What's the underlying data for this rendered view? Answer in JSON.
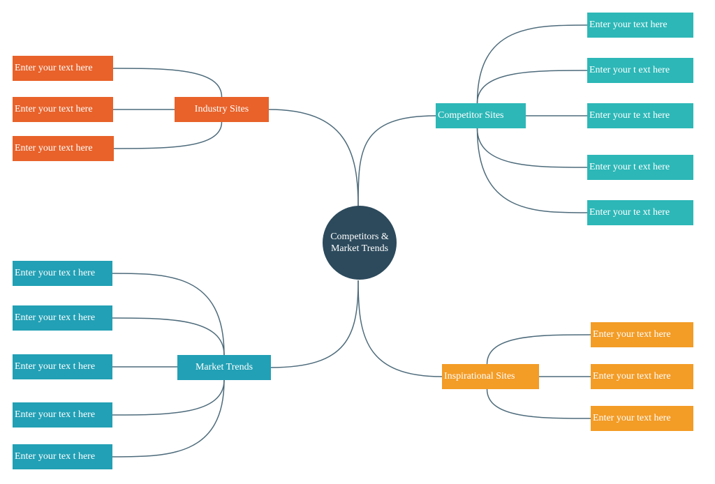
{
  "colors": {
    "link": "#4d6b7b",
    "center": "#2c4a5c",
    "industry": "#e8622a",
    "competitor": "#2db7b7",
    "market": "#22a0b5",
    "inspirational": "#f39c26"
  },
  "center": {
    "label_line1": "Competitors &",
    "label_line2": "Market Trends"
  },
  "branches": [
    {
      "id": "industry",
      "label": "Industry Sites",
      "color": "#e8622a",
      "leaves": [
        "Enter your text here",
        "Enter your text here",
        "Enter your text here"
      ]
    },
    {
      "id": "competitor",
      "label": "Competitor Sites",
      "color": "#2db7b7",
      "leaves": [
        "Enter your text here",
        "Enter your t ext here",
        "Enter your te xt here",
        "Enter your t ext here",
        "Enter your te xt here"
      ]
    },
    {
      "id": "market",
      "label": "Market Trends",
      "color": "#22a0b5",
      "leaves": [
        "Enter your tex t here",
        "Enter your tex t here",
        "Enter your tex t here",
        "Enter your tex t here",
        "Enter your tex t here"
      ]
    },
    {
      "id": "inspirational",
      "label": "Inspirational Sites",
      "color": "#f39c26",
      "leaves": [
        "Enter your text here",
        "Enter your text here",
        "Enter your text here"
      ]
    }
  ]
}
